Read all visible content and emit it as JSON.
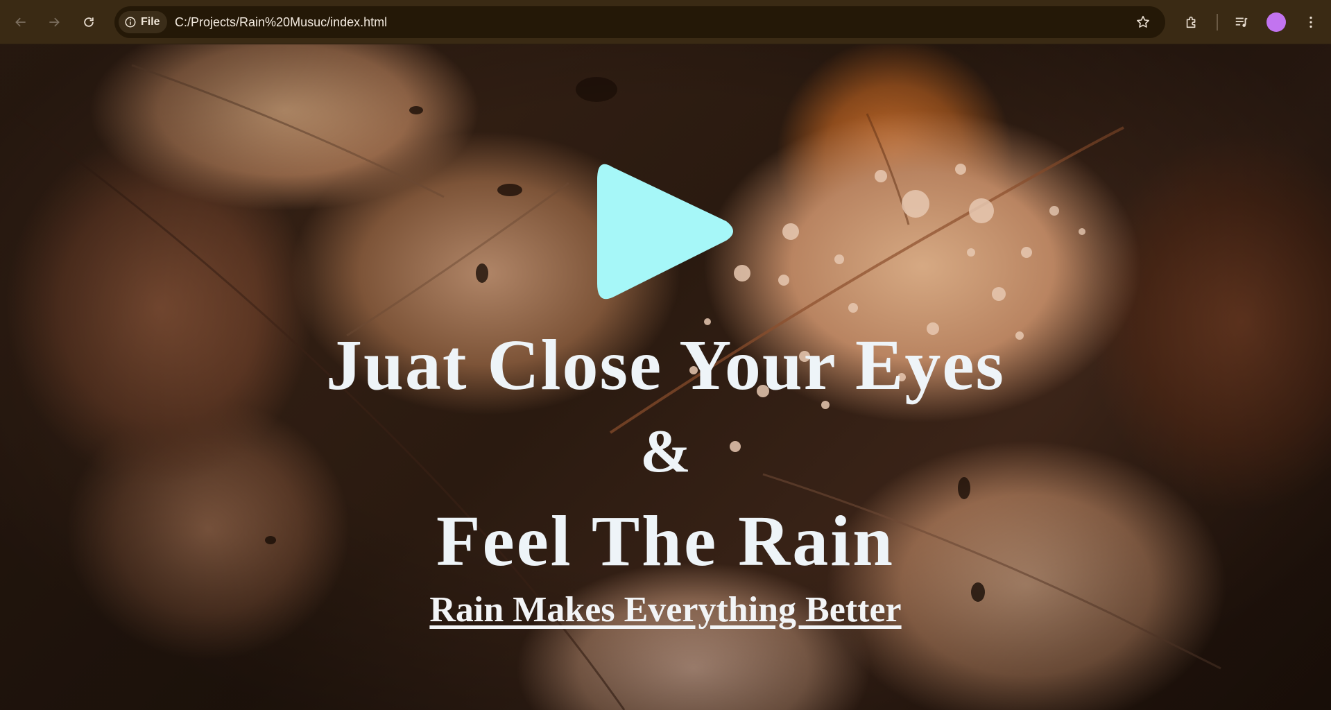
{
  "browser": {
    "site_chip_label": "File",
    "url": "C:/Projects/Rain%20Musuc/index.html",
    "avatar_color": "#c274f0"
  },
  "page": {
    "headline_line1": "Juat Close Your Eyes",
    "headline_line2": "&",
    "headline_line3": "Feel The Rain",
    "tagline": "Rain Makes Everything Better",
    "play_button_color": "#a6f7f8",
    "text_color": "#eef4f8",
    "play_icon": "play-triangle-icon"
  }
}
